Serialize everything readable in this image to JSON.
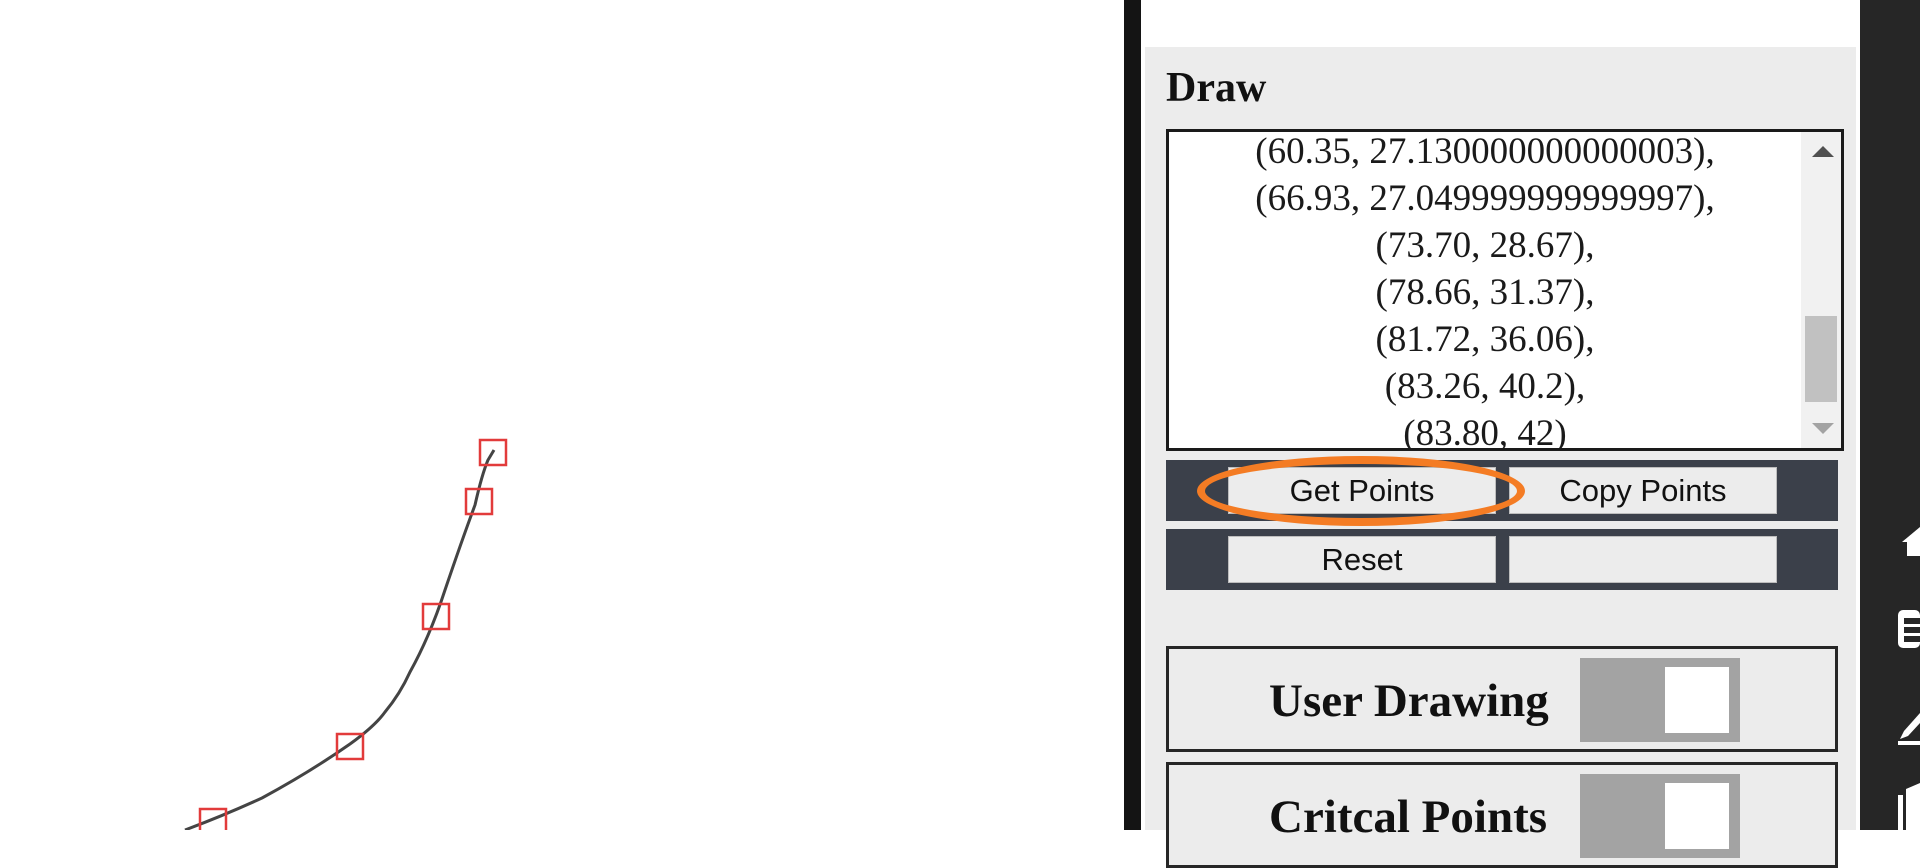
{
  "panel": {
    "title": "Draw",
    "points": [
      "(60.35, 27.130000000000003),",
      "(66.93, 27.049999999999997),",
      "(73.70, 28.67),",
      "(78.66, 31.37),",
      "(81.72, 36.06),",
      "(83.26, 40.2),",
      "(83.80, 42)"
    ],
    "buttons": {
      "get_points": "Get Points",
      "copy_points": "Copy Points",
      "reset": "Reset",
      "blank": ""
    },
    "toggles": {
      "user_drawing": "User Drawing",
      "critical_points": "Critcal Points"
    }
  },
  "colors": {
    "highlight": "#f47c24",
    "marker": "#e23b3b",
    "curve": "#444444",
    "button_bar": "#3b404a"
  },
  "sidebar_icons": [
    "home-icon",
    "list-icon",
    "pencil-icon",
    "book-icon"
  ]
}
